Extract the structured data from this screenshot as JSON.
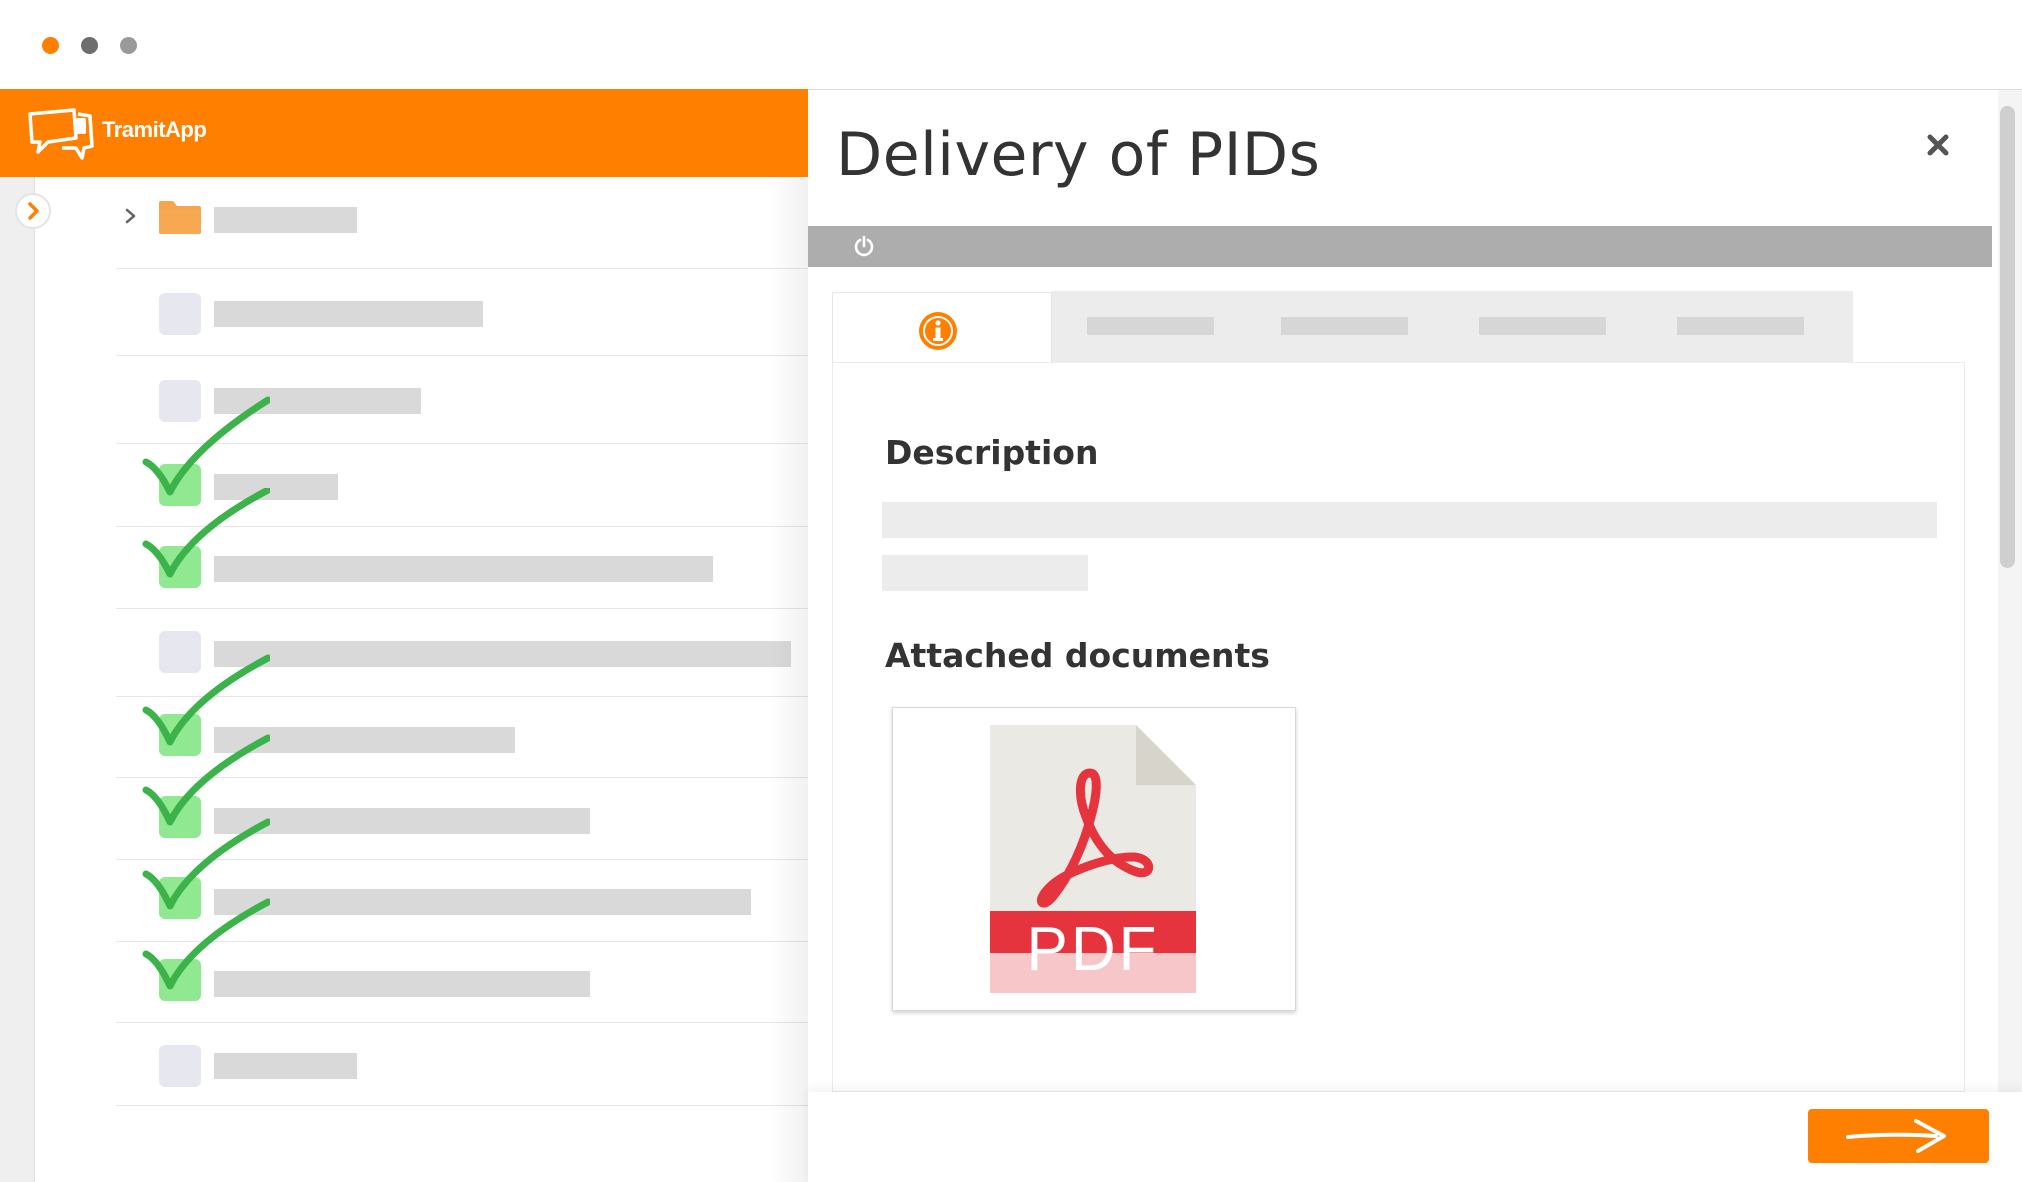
{
  "app": {
    "logo_text": "TramitApp",
    "colors": {
      "brand": "#ff7f00",
      "check": "#3cb34a",
      "pdf_red": "#e5343d"
    }
  },
  "window": {
    "dot_colors": [
      "#ff7f00",
      "#6e6e6e",
      "#9a9a9a"
    ]
  },
  "panel": {
    "title": "Delivery of PIDs",
    "close_icon": "close-icon",
    "toolbar_icon": "power-icon",
    "active_tab_icon": "info-icon",
    "description_heading": "Description",
    "attached_heading": "Attached documents",
    "document": {
      "type_label": "PDF",
      "icon": "pdf-file-icon"
    },
    "next_button_icon": "arrow-right-icon"
  },
  "list": {
    "rows": [
      {
        "kind": "folder",
        "checked": false
      },
      {
        "kind": "item",
        "checked": false
      },
      {
        "kind": "item",
        "checked": false
      },
      {
        "kind": "item",
        "checked": true
      },
      {
        "kind": "item",
        "checked": true
      },
      {
        "kind": "item",
        "checked": false
      },
      {
        "kind": "item",
        "checked": true
      },
      {
        "kind": "item",
        "checked": true
      },
      {
        "kind": "item",
        "checked": true
      },
      {
        "kind": "item",
        "checked": true
      },
      {
        "kind": "item",
        "checked": false
      }
    ]
  }
}
